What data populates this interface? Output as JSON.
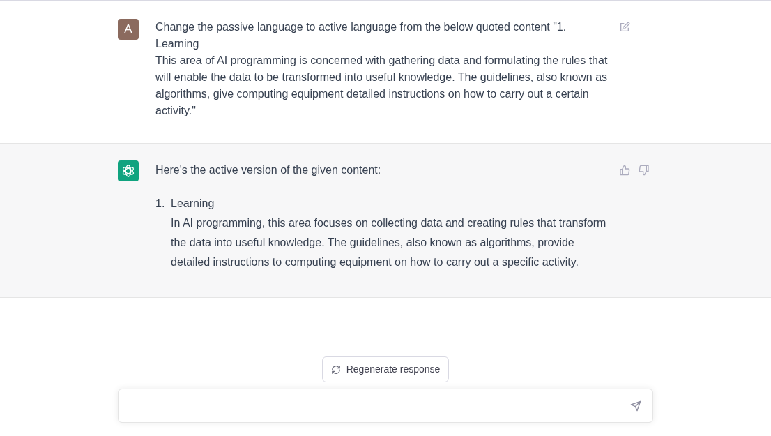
{
  "messages": [
    {
      "kind": "user",
      "avatar_letter": "A",
      "text": "Change the passive language to active language from the below quoted content \"1. Learning\nThis area of AI programming is concerned with gathering data and formulating the rules that will enable the data to be transformed into useful knowledge. The guidelines, also known as algorithms, give computing equipment detailed instructions on how to carry out a certain activity.\""
    },
    {
      "kind": "assistant",
      "text": "Here's the active version of the given content:",
      "list": [
        {
          "number": "1.",
          "title": "Learning",
          "body": "In AI programming, this area focuses on collecting data and creating rules that transform the data into useful knowledge. The guidelines, also known as algorithms, provide detailed instructions to computing equipment on how to carry out a specific activity."
        }
      ]
    }
  ],
  "regenerate_button": "Regenerate response"
}
